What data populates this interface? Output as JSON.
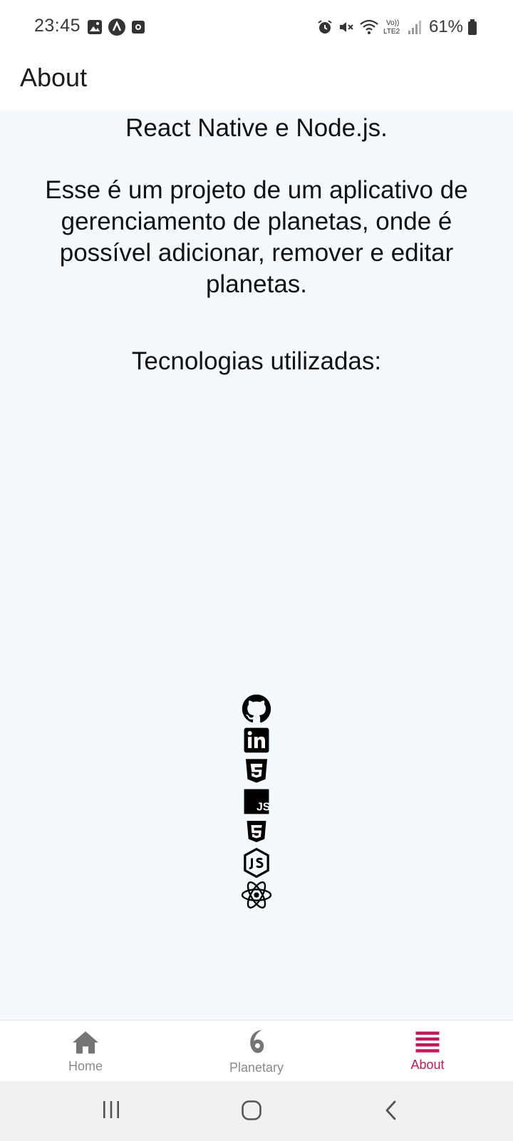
{
  "status_bar": {
    "time": "23:45",
    "left_icons": [
      "gallery-icon",
      "app-a-icon",
      "record-icon"
    ],
    "right_icons": [
      "alarm-icon",
      "mute-icon",
      "wifi-icon",
      "volte-lte2-icon",
      "signal-icon"
    ],
    "battery_percent": "61%"
  },
  "header": {
    "title": "About"
  },
  "content": {
    "line1": "React Native e Node.js.",
    "paragraph": "Esse é um projeto de um aplicativo de gerenciamento de planetas, onde é possível adicionar, remover e editar planetas.",
    "tech_heading": "Tecnologias utilizadas:",
    "tech_icons": [
      "github-icon",
      "linkedin-icon",
      "css3-icon",
      "javascript-icon",
      "html5-icon",
      "nodejs-icon",
      "react-icon"
    ],
    "js_label": "JS"
  },
  "tabs": [
    {
      "label": "Home",
      "icon": "home-icon",
      "active": false
    },
    {
      "label": "Planetary",
      "icon": "planetary-icon",
      "active": false
    },
    {
      "label": "About",
      "icon": "menu-icon",
      "active": true
    }
  ],
  "colors": {
    "accent": "#c2185b",
    "inactive": "#8a8a8a",
    "content_bg": "#f3f9fc"
  },
  "nav_bar": [
    "recents-button",
    "home-button",
    "back-button"
  ]
}
